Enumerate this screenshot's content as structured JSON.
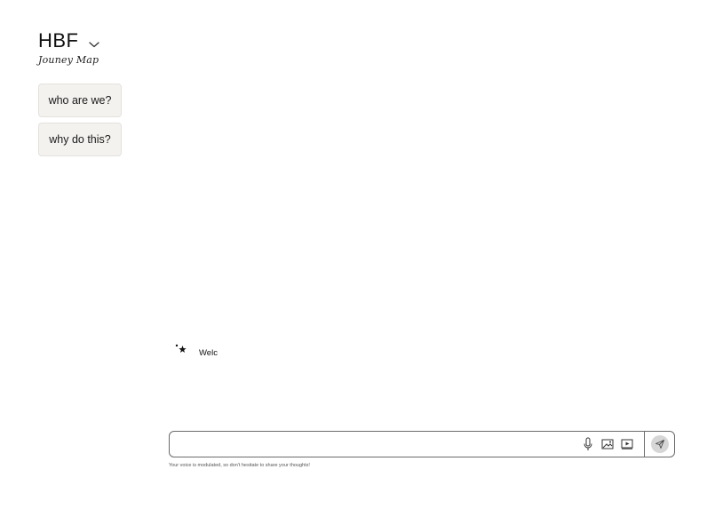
{
  "brand": {
    "title": "HBF",
    "subtitle": "Jouney Map",
    "dropdown_icon": "chevron-down-icon"
  },
  "prompts": [
    {
      "label": "who are we?"
    },
    {
      "label": "why do this?"
    }
  ],
  "messages": [
    {
      "author_icon": "sparkle-icon",
      "text": "Welc"
    }
  ],
  "composer": {
    "value": "",
    "placeholder": "",
    "tools": [
      "microphone-icon",
      "image-icon",
      "video-icon"
    ],
    "send_icon": "send-icon",
    "hint": "Your voice is modulated, so don't hesitate to share your thoughts!"
  },
  "colors": {
    "prompt_bg": "#f3f2ef",
    "border": "#6b6b6b",
    "send_bg": "#d6d6d6"
  }
}
